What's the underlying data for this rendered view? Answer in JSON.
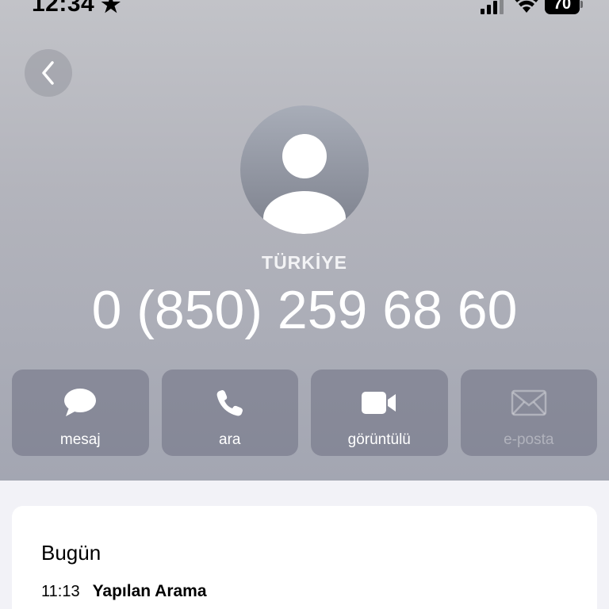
{
  "status_bar": {
    "time": "12:34",
    "battery": "70"
  },
  "contact": {
    "country": "TÜRKİYE",
    "phone": "0 (850) 259 68 60"
  },
  "actions": [
    {
      "label": "mesaj",
      "icon": "message-bubble-icon",
      "enabled": true
    },
    {
      "label": "ara",
      "icon": "phone-icon",
      "enabled": true
    },
    {
      "label": "görüntülü",
      "icon": "video-camera-icon",
      "enabled": true
    },
    {
      "label": "e-posta",
      "icon": "envelope-icon",
      "enabled": false
    }
  ],
  "history": {
    "title": "Bugün",
    "calls": [
      {
        "time": "11:13",
        "type": "Yapılan Arama"
      }
    ]
  },
  "colors": {
    "header_top": "#c2c3c8",
    "header_bottom": "#a3a6b2",
    "action_bg": "#6e7082",
    "page_bg": "#f2f2f7"
  }
}
